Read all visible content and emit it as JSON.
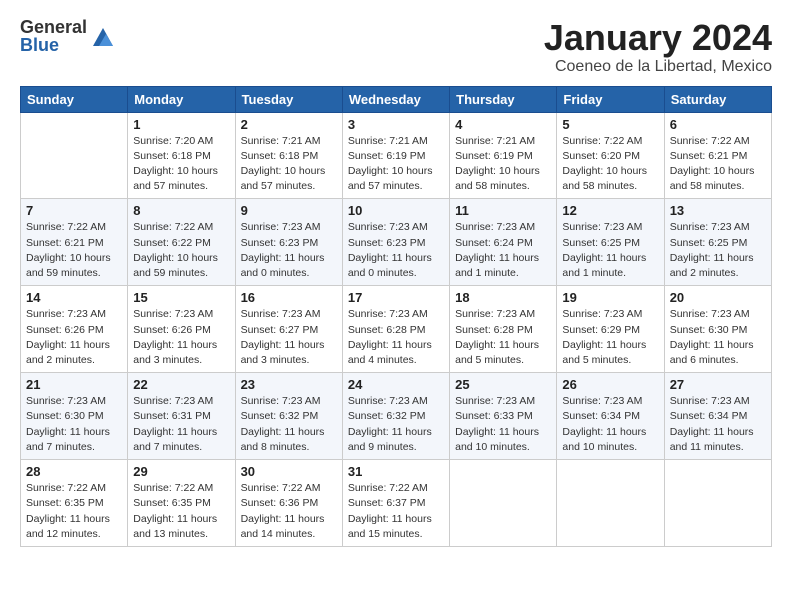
{
  "header": {
    "logo_general": "General",
    "logo_blue": "Blue",
    "month_title": "January 2024",
    "subtitle": "Coeneo de la Libertad, Mexico"
  },
  "weekdays": [
    "Sunday",
    "Monday",
    "Tuesday",
    "Wednesday",
    "Thursday",
    "Friday",
    "Saturday"
  ],
  "weeks": [
    [
      {
        "day": "",
        "info": ""
      },
      {
        "day": "1",
        "info": "Sunrise: 7:20 AM\nSunset: 6:18 PM\nDaylight: 10 hours\nand 57 minutes."
      },
      {
        "day": "2",
        "info": "Sunrise: 7:21 AM\nSunset: 6:18 PM\nDaylight: 10 hours\nand 57 minutes."
      },
      {
        "day": "3",
        "info": "Sunrise: 7:21 AM\nSunset: 6:19 PM\nDaylight: 10 hours\nand 57 minutes."
      },
      {
        "day": "4",
        "info": "Sunrise: 7:21 AM\nSunset: 6:19 PM\nDaylight: 10 hours\nand 58 minutes."
      },
      {
        "day": "5",
        "info": "Sunrise: 7:22 AM\nSunset: 6:20 PM\nDaylight: 10 hours\nand 58 minutes."
      },
      {
        "day": "6",
        "info": "Sunrise: 7:22 AM\nSunset: 6:21 PM\nDaylight: 10 hours\nand 58 minutes."
      }
    ],
    [
      {
        "day": "7",
        "info": "Sunrise: 7:22 AM\nSunset: 6:21 PM\nDaylight: 10 hours\nand 59 minutes."
      },
      {
        "day": "8",
        "info": "Sunrise: 7:22 AM\nSunset: 6:22 PM\nDaylight: 10 hours\nand 59 minutes."
      },
      {
        "day": "9",
        "info": "Sunrise: 7:23 AM\nSunset: 6:23 PM\nDaylight: 11 hours\nand 0 minutes."
      },
      {
        "day": "10",
        "info": "Sunrise: 7:23 AM\nSunset: 6:23 PM\nDaylight: 11 hours\nand 0 minutes."
      },
      {
        "day": "11",
        "info": "Sunrise: 7:23 AM\nSunset: 6:24 PM\nDaylight: 11 hours\nand 1 minute."
      },
      {
        "day": "12",
        "info": "Sunrise: 7:23 AM\nSunset: 6:25 PM\nDaylight: 11 hours\nand 1 minute."
      },
      {
        "day": "13",
        "info": "Sunrise: 7:23 AM\nSunset: 6:25 PM\nDaylight: 11 hours\nand 2 minutes."
      }
    ],
    [
      {
        "day": "14",
        "info": "Sunrise: 7:23 AM\nSunset: 6:26 PM\nDaylight: 11 hours\nand 2 minutes."
      },
      {
        "day": "15",
        "info": "Sunrise: 7:23 AM\nSunset: 6:26 PM\nDaylight: 11 hours\nand 3 minutes."
      },
      {
        "day": "16",
        "info": "Sunrise: 7:23 AM\nSunset: 6:27 PM\nDaylight: 11 hours\nand 3 minutes."
      },
      {
        "day": "17",
        "info": "Sunrise: 7:23 AM\nSunset: 6:28 PM\nDaylight: 11 hours\nand 4 minutes."
      },
      {
        "day": "18",
        "info": "Sunrise: 7:23 AM\nSunset: 6:28 PM\nDaylight: 11 hours\nand 5 minutes."
      },
      {
        "day": "19",
        "info": "Sunrise: 7:23 AM\nSunset: 6:29 PM\nDaylight: 11 hours\nand 5 minutes."
      },
      {
        "day": "20",
        "info": "Sunrise: 7:23 AM\nSunset: 6:30 PM\nDaylight: 11 hours\nand 6 minutes."
      }
    ],
    [
      {
        "day": "21",
        "info": "Sunrise: 7:23 AM\nSunset: 6:30 PM\nDaylight: 11 hours\nand 7 minutes."
      },
      {
        "day": "22",
        "info": "Sunrise: 7:23 AM\nSunset: 6:31 PM\nDaylight: 11 hours\nand 7 minutes."
      },
      {
        "day": "23",
        "info": "Sunrise: 7:23 AM\nSunset: 6:32 PM\nDaylight: 11 hours\nand 8 minutes."
      },
      {
        "day": "24",
        "info": "Sunrise: 7:23 AM\nSunset: 6:32 PM\nDaylight: 11 hours\nand 9 minutes."
      },
      {
        "day": "25",
        "info": "Sunrise: 7:23 AM\nSunset: 6:33 PM\nDaylight: 11 hours\nand 10 minutes."
      },
      {
        "day": "26",
        "info": "Sunrise: 7:23 AM\nSunset: 6:34 PM\nDaylight: 11 hours\nand 10 minutes."
      },
      {
        "day": "27",
        "info": "Sunrise: 7:23 AM\nSunset: 6:34 PM\nDaylight: 11 hours\nand 11 minutes."
      }
    ],
    [
      {
        "day": "28",
        "info": "Sunrise: 7:22 AM\nSunset: 6:35 PM\nDaylight: 11 hours\nand 12 minutes."
      },
      {
        "day": "29",
        "info": "Sunrise: 7:22 AM\nSunset: 6:35 PM\nDaylight: 11 hours\nand 13 minutes."
      },
      {
        "day": "30",
        "info": "Sunrise: 7:22 AM\nSunset: 6:36 PM\nDaylight: 11 hours\nand 14 minutes."
      },
      {
        "day": "31",
        "info": "Sunrise: 7:22 AM\nSunset: 6:37 PM\nDaylight: 11 hours\nand 15 minutes."
      },
      {
        "day": "",
        "info": ""
      },
      {
        "day": "",
        "info": ""
      },
      {
        "day": "",
        "info": ""
      }
    ]
  ]
}
